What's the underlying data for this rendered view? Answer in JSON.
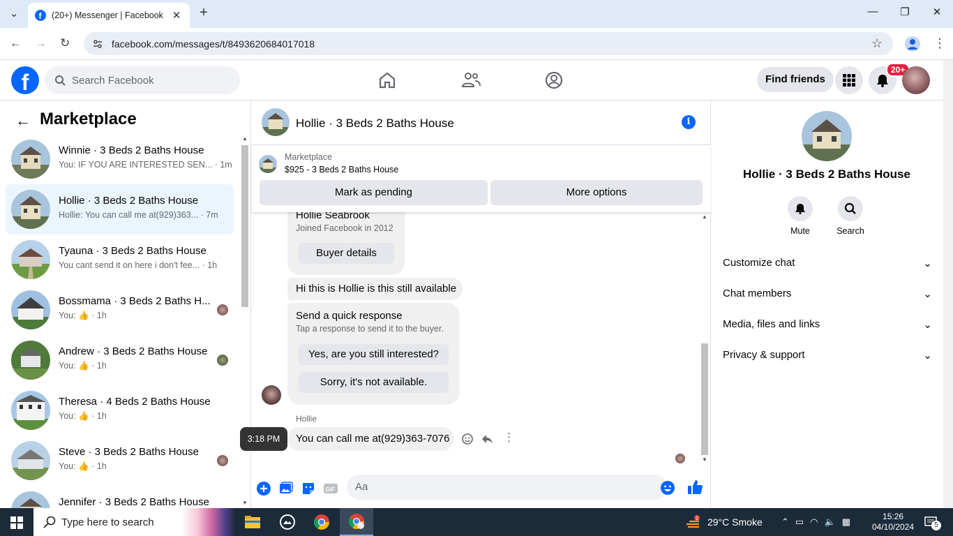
{
  "browser": {
    "tab_title": "(20+) Messenger | Facebook",
    "url": "facebook.com/messages/t/8493620684017018"
  },
  "fb": {
    "search_placeholder": "Search Facebook",
    "find_friends": "Find friends",
    "notif_badge": "20+"
  },
  "left": {
    "title": "Marketplace",
    "conversations": [
      {
        "name": "Winnie · 3 Beds 2 Baths House",
        "preview": "You: IF YOU ARE INTERESTED SEN...",
        "time": "· 1m"
      },
      {
        "name": "Hollie · 3 Beds 2 Baths House",
        "preview": "Hollie: You can call me at(929)363...",
        "time": "· 7m"
      },
      {
        "name": "Tyauna · 3 Beds 2 Baths House",
        "preview": "You cant send it on here i don't fee...",
        "time": "· 1h"
      },
      {
        "name": "Bossmama · 3 Beds 2 Baths H...",
        "preview": "You:",
        "time": "· 1h"
      },
      {
        "name": "Andrew · 3 Beds 2 Baths House",
        "preview": "You:",
        "time": "· 1h"
      },
      {
        "name": "Theresa · 4 Beds 2 Baths House",
        "preview": "You:",
        "time": "· 1h"
      },
      {
        "name": "Steve · 3 Beds 2 Baths House",
        "preview": "You:",
        "time": "· 1h"
      },
      {
        "name": "Jennifer · 3 Beds 2 Baths House",
        "preview": "",
        "time": ""
      }
    ]
  },
  "chat": {
    "title": "Hollie · 3 Beds 2 Baths House",
    "marketplace_label": "Marketplace",
    "listing": "$925 - 3 Beds 2 Baths House",
    "mark_pending": "Mark as pending",
    "more_options": "More options",
    "buyer_name": "Hollie Seabrook",
    "buyer_joined": "Joined Facebook in 2012",
    "buyer_details": "Buyer details",
    "msg1": "Hi this is Hollie is this still available",
    "quick_title": "Send a quick response",
    "quick_sub": "Tap a response to send it to the buyer.",
    "quick_opt1": "Yes, are you still interested?",
    "quick_opt2": "Sorry, it's not available.",
    "sender": "Hollie",
    "msg2": "You can call me at(929)363-7076",
    "tooltip_time": "3:18 PM",
    "composer_placeholder": "Aa"
  },
  "right": {
    "title": "Hollie · 3 Beds 2 Baths House",
    "mute": "Mute",
    "search": "Search",
    "sections": [
      "Customize chat",
      "Chat members",
      "Media, files and links",
      "Privacy & support"
    ]
  },
  "taskbar": {
    "search": "Type here to search",
    "weather": "29°C  Smoke",
    "time": "15:26",
    "date": "04/10/2024",
    "notif_count": "5"
  }
}
